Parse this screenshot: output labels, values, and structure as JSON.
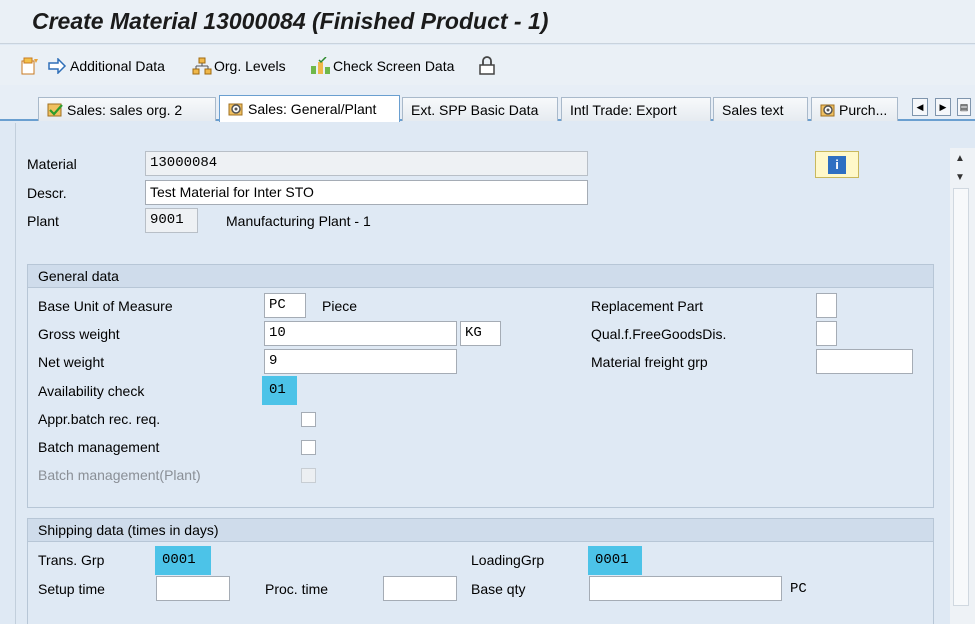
{
  "window": {
    "title": "Create Material 13000084 (Finished Product - 1)"
  },
  "toolbar": {
    "additional_data": "Additional Data",
    "org_levels": "Org. Levels",
    "check_screen_data": "Check Screen Data"
  },
  "tabs": [
    {
      "label": "Sales: sales org. 2"
    },
    {
      "label": "Sales: General/Plant"
    },
    {
      "label": "Ext. SPP Basic Data"
    },
    {
      "label": "Intl Trade: Export"
    },
    {
      "label": "Sales text"
    },
    {
      "label": "Purch..."
    }
  ],
  "header": {
    "material_label": "Material",
    "material_value": "13000084",
    "descr_label": "Descr.",
    "descr_value": "Test Material for Inter STO",
    "plant_label": "Plant",
    "plant_value": "9001",
    "plant_text": "Manufacturing Plant - 1"
  },
  "general": {
    "title": "General data",
    "base_uom_label": "Base Unit of Measure",
    "base_uom_value": "PC",
    "base_uom_text": "Piece",
    "gross_weight_label": "Gross weight",
    "gross_weight_value": "10",
    "weight_unit": "KG",
    "net_weight_label": "Net weight",
    "net_weight_value": "9",
    "avail_check_label": "Availability check",
    "avail_check_value": "01",
    "appr_batch_label": "Appr.batch rec. req.",
    "batch_mgmt_label": "Batch management",
    "batch_mgmt_plant_label": "Batch management(Plant)",
    "replacement_part_label": "Replacement Part",
    "qual_free_goods_label": "Qual.f.FreeGoodsDis.",
    "material_freight_label": "Material freight grp"
  },
  "shipping": {
    "title": "Shipping data (times in days)",
    "trans_grp_label": "Trans. Grp",
    "trans_grp_value": "0001",
    "loading_grp_label": "LoadingGrp",
    "loading_grp_value": "0001",
    "setup_time_label": "Setup time",
    "proc_time_label": "Proc. time",
    "base_qty_label": "Base qty",
    "base_qty_unit": "PC"
  },
  "colors": {
    "highlight": "#4cc3e8",
    "tab_accent": "#6a9fd0",
    "info_icon": "#2e6fc2"
  }
}
